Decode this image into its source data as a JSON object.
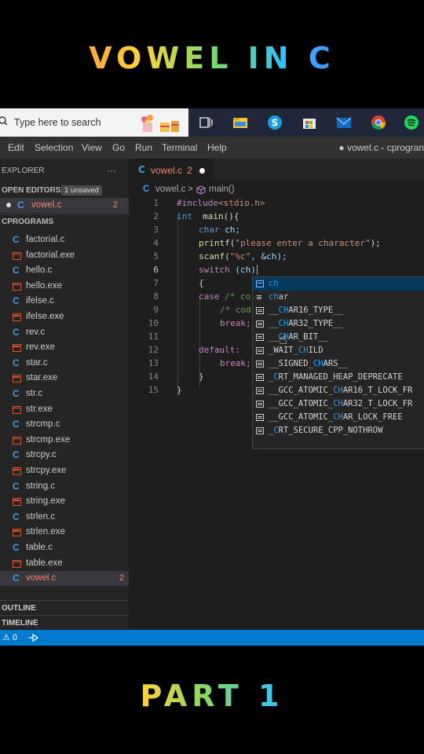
{
  "overlay": {
    "title_top": "VOWEL IN C",
    "title_bottom": "PART 1"
  },
  "taskbar": {
    "search_placeholder": "Type here to search"
  },
  "menu": {
    "items": [
      "Edit",
      "Selection",
      "View",
      "Go",
      "Run",
      "Terminal",
      "Help"
    ],
    "window_title": "● vowel.c - cprogran"
  },
  "sidebar": {
    "explorer_label": "EXPLORER",
    "more": "···",
    "open_editors_label": "OPEN EDITORS",
    "unsaved_badge": "1 unsaved",
    "open_file": "vowel.c",
    "open_file_count": "2",
    "folder_label": "CPROGRAMS",
    "files": [
      "factorial.c",
      "factorial.exe",
      "hello.c",
      "hello.exe",
      "ifelse.c",
      "ifelse.exe",
      "rev.c",
      "rev.exe",
      "star.c",
      "star.exe",
      "str.c",
      "str.exe",
      "strcmp.c",
      "strcmp.exe",
      "strcpy.c",
      "strcpy.exe",
      "string.c",
      "string.exe",
      "strlen.c",
      "strlen.exe",
      "table.c",
      "table.exe",
      "vowel.c"
    ],
    "vowel_count": "2",
    "outline_label": "OUTLINE",
    "timeline_label": "TIMELINE"
  },
  "tab": {
    "name": "vowel.c",
    "count": "2"
  },
  "breadcrumb": {
    "file": "vowel.c",
    "sep": ">",
    "symbol": "main()"
  },
  "editor": {
    "line_numbers": [
      "1",
      "2",
      "3",
      "4",
      "5",
      "6",
      "7",
      "8",
      "9",
      "10",
      "11",
      "12",
      "13",
      "14",
      "15"
    ],
    "lines": {
      "l1_pp": "#include",
      "l1_inc": "<stdio.h>",
      "l2_kw": "int",
      "l2_fn": "main",
      "l2_rest": "(){",
      "l3_kw": "char",
      "l3_rest": " ch;",
      "l4_fn": "printf",
      "l4_open": "(",
      "l4_str": "\"please enter a character\"",
      "l4_close": ");",
      "l5_fn": "scanf",
      "l5_open": "(",
      "l5_str": "\"%c\"",
      "l5_rest": ", &ch);",
      "l6_kw": "switch",
      "l6_rest": " (ch)",
      "l7": "{",
      "l8_kw": "case",
      "l8_cm": "/* co",
      "l9_cm": "/* cod",
      "l10_kw": "break;",
      "l12_kw": "default:",
      "l13_kw": "break;",
      "l14": "}",
      "l15": "}"
    }
  },
  "suggest": {
    "items": [
      {
        "pre": "",
        "hl": "ch",
        "post": "",
        "kind": "var"
      },
      {
        "pre": "",
        "hl": "ch",
        "post": "ar",
        "kind": "kw"
      },
      {
        "pre": "__",
        "hl": "CH",
        "post": "AR16_TYPE__",
        "kind": "const"
      },
      {
        "pre": "__",
        "hl": "CH",
        "post": "AR32_TYPE__",
        "kind": "const"
      },
      {
        "pre": "__",
        "hl": "CH",
        "post": "AR_BIT__",
        "kind": "const"
      },
      {
        "pre": "_WAIT_",
        "hl": "CH",
        "post": "ILD",
        "kind": "const"
      },
      {
        "pre": "__SIGNED_",
        "hl": "CH",
        "post": "ARS__",
        "kind": "const"
      },
      {
        "pre": "_",
        "hl": "C",
        "post": "RT_MANAGED_HEAP_DEPRECATE",
        "kind": "const"
      },
      {
        "pre": "__GCC_ATOMIC_",
        "hl": "CH",
        "post": "AR16_T_LOCK_FR",
        "kind": "const"
      },
      {
        "pre": "__GCC_ATOMIC_",
        "hl": "CH",
        "post": "AR32_T_LOCK_FR",
        "kind": "const"
      },
      {
        "pre": "__GCC_ATOMIC_",
        "hl": "CH",
        "post": "AR_LOCK_FREE",
        "kind": "const"
      },
      {
        "pre": "_",
        "hl": "C",
        "post": "RT_SECURE_CPP_NOTHROW",
        "kind": "const"
      }
    ]
  },
  "status": {
    "problems": "⚠ 0"
  },
  "colors": {
    "accent": "#007acc",
    "error": "#f48771",
    "c_icon": "#3e9ce6"
  }
}
